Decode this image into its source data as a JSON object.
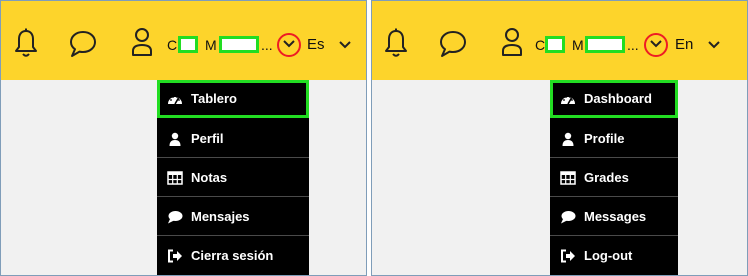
{
  "colors": {
    "topbar": "#fdd42b",
    "menu_background": "#000000",
    "highlight": "#22dd22",
    "dropdown_circle": "#ee1c24",
    "page_background": "#f1f1f1"
  },
  "panels": [
    {
      "language": "Es",
      "user_initial_1": "C",
      "user_initial_2": "M",
      "ellipsis": "...",
      "menu": [
        {
          "label": "Tablero",
          "icon": "dashboard-gauge-icon",
          "active": true
        },
        {
          "label": "Perfil",
          "icon": "user-icon",
          "active": false
        },
        {
          "label": "Notas",
          "icon": "table-grid-icon",
          "active": false
        },
        {
          "label": "Mensajes",
          "icon": "speech-bubble-icon",
          "active": false
        },
        {
          "label": "Cierra sesión",
          "icon": "sign-out-icon",
          "active": false
        }
      ]
    },
    {
      "language": "En",
      "user_initial_1": "C",
      "user_initial_2": "M",
      "ellipsis": "...",
      "menu": [
        {
          "label": "Dashboard",
          "icon": "dashboard-gauge-icon",
          "active": true
        },
        {
          "label": "Profile",
          "icon": "user-icon",
          "active": false
        },
        {
          "label": "Grades",
          "icon": "table-grid-icon",
          "active": false
        },
        {
          "label": "Messages",
          "icon": "speech-bubble-icon",
          "active": false
        },
        {
          "label": "Log-out",
          "icon": "sign-out-icon",
          "active": false
        }
      ]
    }
  ]
}
